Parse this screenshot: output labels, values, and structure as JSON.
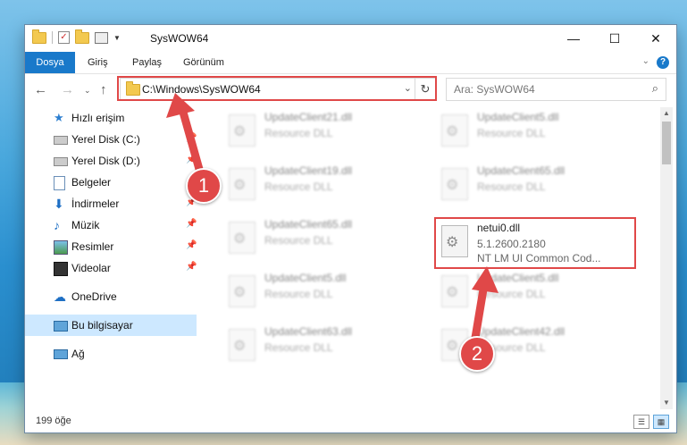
{
  "window": {
    "title": "SysWOW64"
  },
  "ribbon": {
    "tabs": [
      "Dosya",
      "Giriş",
      "Paylaş",
      "Görünüm"
    ]
  },
  "nav": {
    "address": "C:\\Windows\\SysWOW64",
    "search_placeholder": "Ara: SysWOW64"
  },
  "sidebar": {
    "items": [
      {
        "label": "Hızlı erişim",
        "icon": "star-icon"
      },
      {
        "label": "Yerel Disk (C:)",
        "icon": "drive-icon",
        "pinned": true
      },
      {
        "label": "Yerel Disk (D:)",
        "icon": "drive-icon",
        "pinned": true
      },
      {
        "label": "Belgeler",
        "icon": "documents-icon",
        "pinned": true
      },
      {
        "label": "İndirmeler",
        "icon": "download-icon",
        "pinned": true
      },
      {
        "label": "Müzik",
        "icon": "music-icon",
        "pinned": true
      },
      {
        "label": "Resimler",
        "icon": "pictures-icon",
        "pinned": true
      },
      {
        "label": "Videolar",
        "icon": "video-icon",
        "pinned": true
      },
      {
        "label": "OneDrive",
        "icon": "cloud-icon"
      },
      {
        "label": "Bu bilgisayar",
        "icon": "computer-icon",
        "selected": true
      },
      {
        "label": "Ağ",
        "icon": "network-icon"
      }
    ]
  },
  "files": [
    {
      "name": "UpdateClient21.dll",
      "line2": "Resource DLL",
      "line3": ""
    },
    {
      "name": "UpdateClient5.dll",
      "line2": "Resource DLL",
      "line3": ""
    },
    {
      "name": "UpdateClient19.dll",
      "line2": "Resource DLL",
      "line3": ""
    },
    {
      "name": "UpdateClient65.dll",
      "line2": "Resource DLL",
      "line3": ""
    },
    {
      "name": "UpdateClient65.dll",
      "line2": "Resource DLL",
      "line3": ""
    },
    {
      "name": "netui0.dll",
      "line2": "5.1.2600.2180",
      "line3": "NT LM UI Common Cod..."
    },
    {
      "name": "UpdateClient5.dll",
      "line2": "Resource DLL",
      "line3": ""
    },
    {
      "name": "UpdateClient5.dll",
      "line2": "Resource DLL",
      "line3": ""
    },
    {
      "name": "UpdateClient63.dll",
      "line2": "Resource DLL",
      "line3": ""
    },
    {
      "name": "UpdateClient42.dll",
      "line2": "Resource DLL",
      "line3": ""
    }
  ],
  "status": {
    "item_count": "199 öğe"
  },
  "annotations": {
    "step1": "1",
    "step2": "2",
    "color": "#e04848"
  }
}
